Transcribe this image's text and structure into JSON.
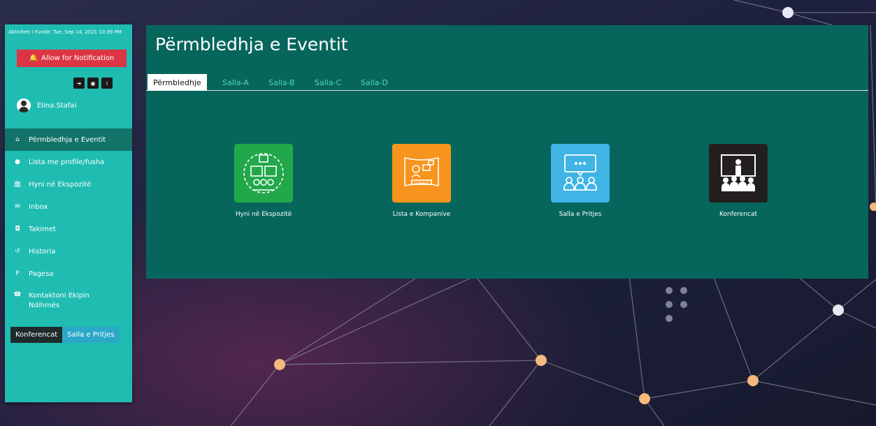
{
  "sidebar": {
    "last_activity": "Aktiviteti i Fundit: Tue, Sep 14, 2021 10:39 PM",
    "notification_label": "Allow for Notification",
    "username": "Elina.Stafai",
    "nav": [
      {
        "label": "Përmbledhja e Eventit",
        "icon": "home-icon",
        "active": true
      },
      {
        "label": "Lista me profile/fusha",
        "icon": "user-icon"
      },
      {
        "label": "Hyni në Ekspozitë",
        "icon": "bank-icon"
      },
      {
        "label": "Inbox",
        "icon": "envelope-icon"
      },
      {
        "label": "Takimet",
        "icon": "camera-icon"
      },
      {
        "label": "Historia",
        "icon": "history-icon"
      },
      {
        "label": "Pagesa",
        "icon": "paypal-icon"
      },
      {
        "label": "Kontaktoni Ekipin Ndihmës",
        "icon": "phone-icon"
      }
    ],
    "tab_conference": "Konferencat",
    "tab_waiting_room": "Salla e Pritjes"
  },
  "main": {
    "title": "Përmbledhja e Eventit",
    "tabs": [
      "Përmbledhje",
      "Salla-A",
      "Salla-B",
      "Salla-C",
      "Salla-D"
    ],
    "cards": [
      {
        "label": "Hyni në Ekspozitë",
        "color": "#22a84a",
        "icon": "exhibition-icon"
      },
      {
        "label": "Lista e Kompanive",
        "color": "#f7941d",
        "icon": "company-list-icon"
      },
      {
        "label": "Salla e Pritjes",
        "color": "#3fb4e5",
        "icon": "waiting-room-icon"
      },
      {
        "label": "Konferencat",
        "color": "#231f20",
        "icon": "conference-icon"
      }
    ]
  }
}
